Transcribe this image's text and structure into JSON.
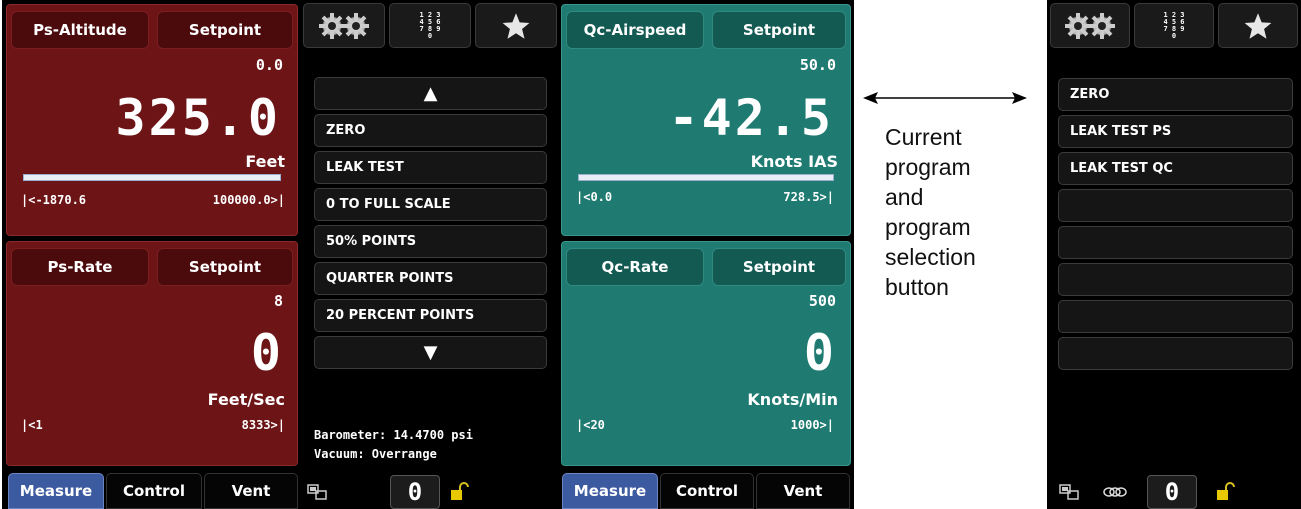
{
  "left_top_panel": {
    "channel": "Ps-Altitude",
    "setpoint_label": "Setpoint",
    "setpoint_value": "0.0",
    "reading": "325.0",
    "unit": "Feet",
    "range_low": "|<-1870.6",
    "range_high": "100000.0>|"
  },
  "left_bottom_panel": {
    "channel": "Ps-Rate",
    "setpoint_label": "Setpoint",
    "setpoint_value": "8",
    "reading": "0",
    "unit": "Feet/Sec",
    "range_low": "|<1",
    "range_high": "8333>|"
  },
  "right_top_panel": {
    "channel": "Qc-Airspeed",
    "setpoint_label": "Setpoint",
    "setpoint_value": "50.0",
    "reading": "-42.5",
    "unit": "Knots IAS",
    "range_low": "|<0.0",
    "range_high": "728.5>|"
  },
  "right_bottom_panel": {
    "channel": "Qc-Rate",
    "setpoint_label": "Setpoint",
    "setpoint_value": "500",
    "reading": "0",
    "unit": "Knots/Min",
    "range_low": "|<20",
    "range_high": "1000>|"
  },
  "keypad_digits": [
    "1 2 3",
    "4 5 6",
    "7 8 9",
    "0"
  ],
  "program_list": {
    "up_arrow": "▲",
    "items": [
      "ZERO",
      "LEAK TEST",
      "0 TO FULL SCALE",
      "50% POINTS",
      "QUARTER POINTS",
      "20 PERCENT POINTS"
    ],
    "down_arrow": "▼"
  },
  "status": {
    "barometer": "Barometer: 14.4700 psi",
    "vacuum": "Vacuum: Overrange"
  },
  "bottom_tabs_left": [
    "Measure",
    "Control",
    "Vent"
  ],
  "bottom_tabs_right": [
    "Measure",
    "Control",
    "Vent"
  ],
  "zero_box": "0",
  "favorites_list": {
    "items": [
      "ZERO",
      "LEAK TEST PS",
      "LEAK TEST QC",
      "",
      "",
      "",
      "",
      ""
    ]
  },
  "annotation": {
    "lines": [
      "Current",
      "program",
      "and",
      "program",
      "selection",
      "button"
    ]
  },
  "icons": [
    "gears-icon",
    "keypad-icon",
    "star-icon",
    "network-icon",
    "chain-link-icon",
    "unlock-icon"
  ],
  "colors": {
    "red_panel": "#6d1416",
    "teal_panel": "#1f7a71",
    "active_tab": "#3c5aa0"
  }
}
